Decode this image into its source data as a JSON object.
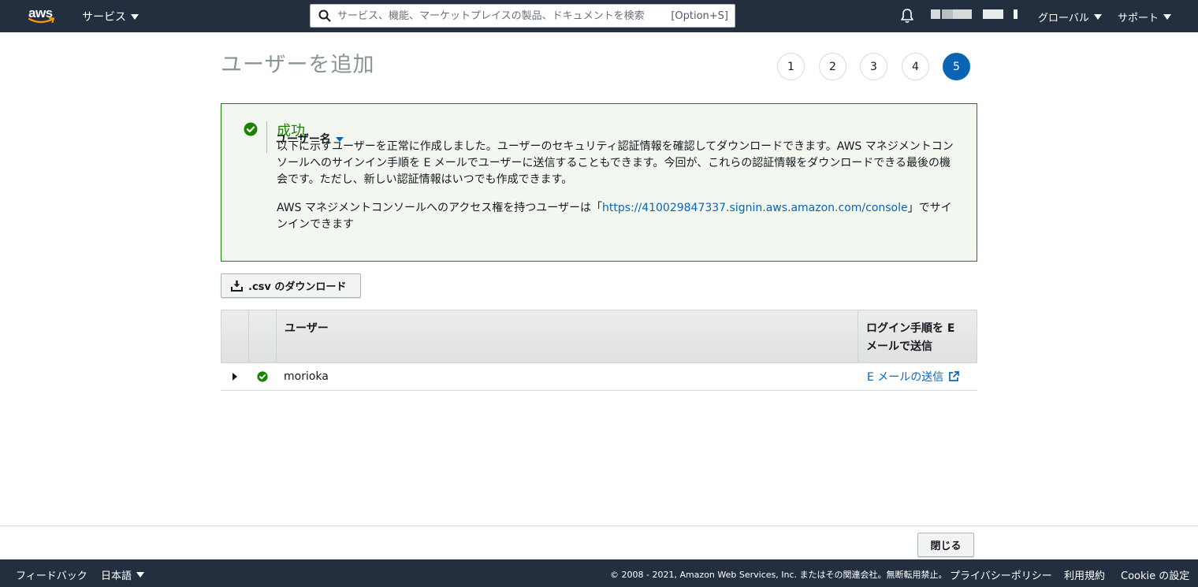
{
  "topnav": {
    "logo_text": "aws",
    "services_label": "サービス",
    "search_placeholder": "サービス、機能、マーケットプレイスの製品、ドキュメントを検索",
    "search_shortcut": "[Option+S]",
    "region_label": "グローバル",
    "support_label": "サポート"
  },
  "page": {
    "title": "ユーザーを追加",
    "steps": [
      "1",
      "2",
      "3",
      "4",
      "5"
    ],
    "active_step": "5"
  },
  "success": {
    "title": "成功",
    "overlay_label": "ユーザー名",
    "paragraph1": "以下に示すユーザーを正常に作成しました。ユーザーのセキュリティ認証情報を確認してダウンロードできます。AWS マネジメントコンソールへのサインイン手順を E メールでユーザーに送信することもできます。今回が、これらの認証情報をダウンロードできる最後の機会です。ただし、新しい認証情報はいつでも作成できます。",
    "paragraph2_prefix": "AWS マネジメントコンソールへのアクセス権を持つユーザーは「",
    "console_url": "https://410029847337.signin.aws.amazon.com/console",
    "paragraph2_suffix": "」でサインインできます"
  },
  "csv_button_label": ".csv のダウンロード",
  "table": {
    "columns": [
      "",
      "",
      "ユーザー",
      "ログイン手順を E メールで送信"
    ],
    "rows": [
      {
        "user": "morioka",
        "status": "success",
        "action_label": "E メールの送信"
      }
    ]
  },
  "actions": {
    "close_label": "閉じる"
  },
  "footer": {
    "feedback": "フィードバック",
    "language": "日本語",
    "copyright": "© 2008 - 2021, Amazon Web Services, Inc. またはその関連会社。無断転用禁止。",
    "privacy": "プライバシーポリシー",
    "terms": "利用規約",
    "cookie": "Cookie の設定"
  },
  "colors": {
    "nav_bg": "#232f3e",
    "success_green": "#1d8102",
    "link_blue": "#0a64b4",
    "active_step": "#0a64b4",
    "aws_orange": "#ff9900"
  },
  "icons": {
    "logo": "aws-smile-logo",
    "search": "search-icon",
    "bell": "bell-icon",
    "success": "check-circle-icon",
    "download": "download-icon",
    "expand": "caret-right-icon",
    "external": "external-link-icon"
  }
}
